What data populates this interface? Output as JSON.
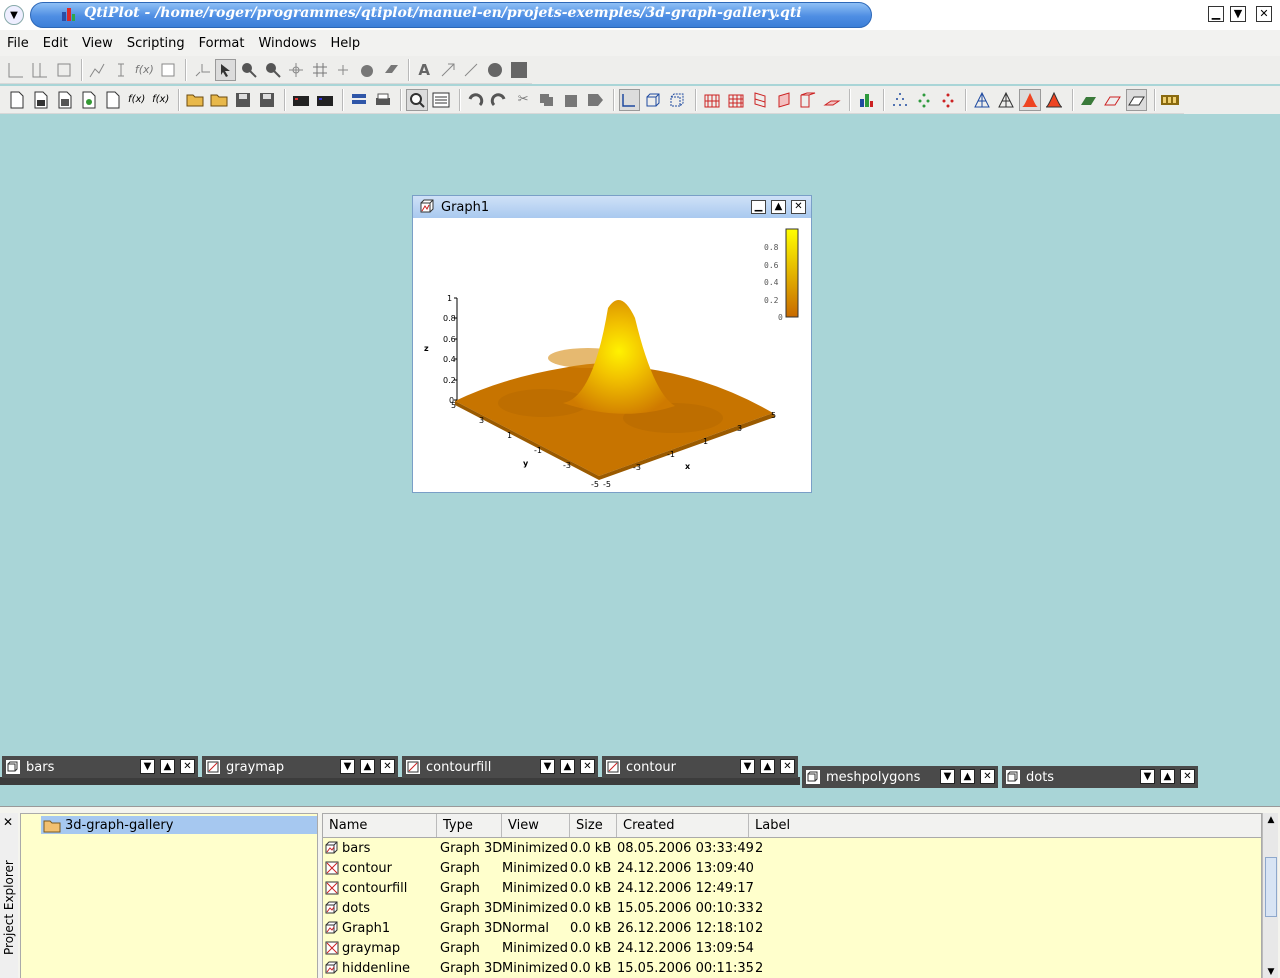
{
  "window": {
    "title": "QtiPlot - /home/roger/programmes/qtiplot/manuel-en/projets-exemples/3d-graph-gallery.qti"
  },
  "menu": [
    "File",
    "Edit",
    "View",
    "Scripting",
    "Format",
    "Windows",
    "Help"
  ],
  "graph_window": {
    "title": "Graph1",
    "z_axis_label": "z",
    "y_axis_label": "y",
    "x_axis_label": "x",
    "z_ticks": [
      "1",
      "0.8",
      "0.6",
      "0.4",
      "0.2",
      "0"
    ],
    "y_ticks": [
      "5",
      "3",
      "1",
      "-1",
      "-3",
      "-5"
    ],
    "x_ticks": [
      "5",
      "3",
      "1",
      "-1",
      "-3",
      "-5"
    ],
    "colorbar_ticks": [
      "0.8",
      "0.6",
      "0.4",
      "0.2",
      "0"
    ],
    "colors": {
      "low": "#c86a00",
      "high": "#ffff00"
    }
  },
  "minimized_windows": [
    {
      "name": "bars"
    },
    {
      "name": "graymap"
    },
    {
      "name": "contourfill"
    },
    {
      "name": "contour"
    },
    {
      "name": "meshpolygons"
    },
    {
      "name": "dots"
    }
  ],
  "explorer": {
    "side_label": "Project Explorer",
    "folder": "3d-graph-gallery",
    "columns": [
      "Name",
      "Type",
      "View",
      "Size",
      "Created",
      "Label"
    ],
    "rows": [
      {
        "name": "bars",
        "type": "Graph 3D",
        "view": "Minimized",
        "size": "0.0 kB",
        "created": "08.05.2006 03:33:49",
        "label": "2"
      },
      {
        "name": "contour",
        "type": "Graph",
        "view": "Minimized",
        "size": "0.0 kB",
        "created": "24.12.2006 13:09:40",
        "label": ""
      },
      {
        "name": "contourfill",
        "type": "Graph",
        "view": "Minimized",
        "size": "0.0 kB",
        "created": "24.12.2006 12:49:17",
        "label": ""
      },
      {
        "name": "dots",
        "type": "Graph 3D",
        "view": "Minimized",
        "size": "0.0 kB",
        "created": "15.05.2006 00:10:33",
        "label": "2"
      },
      {
        "name": "Graph1",
        "type": "Graph 3D",
        "view": "Normal",
        "size": "0.0 kB",
        "created": "26.12.2006 12:18:10",
        "label": "2"
      },
      {
        "name": "graymap",
        "type": "Graph",
        "view": "Minimized",
        "size": "0.0 kB",
        "created": "24.12.2006 13:09:54",
        "label": ""
      },
      {
        "name": "hiddenline",
        "type": "Graph 3D",
        "view": "Minimized",
        "size": "0.0 kB",
        "created": "15.05.2006 00:11:35",
        "label": "2"
      }
    ]
  }
}
